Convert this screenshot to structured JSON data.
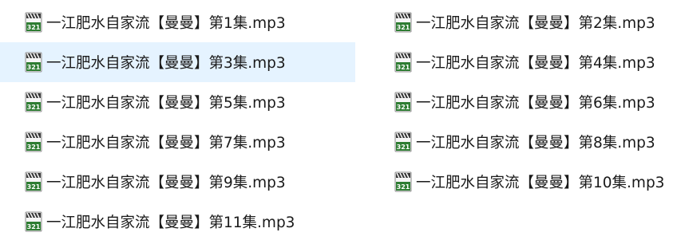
{
  "files": [
    {
      "name": "一江肥水自家流【曼曼】第1集.mp3",
      "icon": "media-player-file-icon",
      "selected": false
    },
    {
      "name": "一江肥水自家流【曼曼】第2集.mp3",
      "icon": "media-player-file-icon",
      "selected": false
    },
    {
      "name": "一江肥水自家流【曼曼】第3集.mp3",
      "icon": "media-player-file-icon",
      "selected": true
    },
    {
      "name": "一江肥水自家流【曼曼】第4集.mp3",
      "icon": "media-player-file-icon",
      "selected": false
    },
    {
      "name": "一江肥水自家流【曼曼】第5集.mp3",
      "icon": "media-player-file-icon",
      "selected": false
    },
    {
      "name": "一江肥水自家流【曼曼】第6集.mp3",
      "icon": "media-player-file-icon",
      "selected": false
    },
    {
      "name": "一江肥水自家流【曼曼】第7集.mp3",
      "icon": "media-player-file-icon",
      "selected": false
    },
    {
      "name": "一江肥水自家流【曼曼】第8集.mp3",
      "icon": "media-player-file-icon",
      "selected": false
    },
    {
      "name": "一江肥水自家流【曼曼】第9集.mp3",
      "icon": "media-player-file-icon",
      "selected": false
    },
    {
      "name": "一江肥水自家流【曼曼】第10集.mp3",
      "icon": "media-player-file-icon",
      "selected": false
    },
    {
      "name": "一江肥水自家流【曼曼】第11集.mp3",
      "icon": "media-player-file-icon",
      "selected": false
    }
  ],
  "colors": {
    "selection_background": "#e5f3ff",
    "text": "#1a1a1a",
    "icon_badge": "#2e7d32",
    "icon_clapper": "#3a3a3a"
  }
}
